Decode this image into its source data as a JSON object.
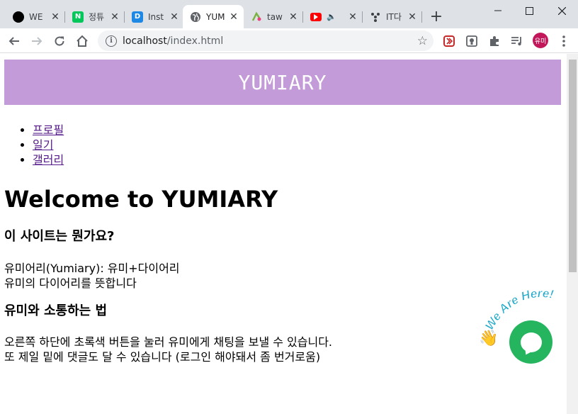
{
  "browser": {
    "tabs": [
      {
        "title": "WE",
        "favicon": "black-circle-icon",
        "color": "#000000",
        "active": false
      },
      {
        "title": "정튜",
        "favicon": "naver-icon",
        "color": "#03c75a",
        "active": false
      },
      {
        "title": "Inst",
        "favicon": "d-letter-icon",
        "color": "#1e88e5",
        "active": false
      },
      {
        "title": "YUM",
        "favicon": "globe-icon",
        "color": "#5f6368",
        "active": true
      },
      {
        "title": "taw",
        "favicon": "tawk-icon",
        "color": "#7cb342",
        "active": false
      },
      {
        "title": "",
        "favicon": "youtube-icon",
        "color": "#ff0000",
        "active": false
      },
      {
        "title": "IT다",
        "favicon": "dots-icon",
        "color": "#3c4043",
        "active": false
      }
    ],
    "address": {
      "host": "localhost",
      "path": "/index.html"
    },
    "profile_label": "유미"
  },
  "page": {
    "banner_title": "YUMIARY",
    "nav": [
      "프로필",
      "일기",
      "갤러리"
    ],
    "heading": "Welcome to YUMIARY",
    "section1": {
      "title": "이 사이트는 뭔가요?",
      "lines": [
        "유미어리(Yumiary): 유미+다이어리",
        "유미의 다이어리를 뜻합니다"
      ]
    },
    "section2": {
      "title": "유미와 소통하는 법",
      "lines": [
        "오른쪽 하단에 초록색 버튼을 눌러 유미에게 채팅을 보낼 수 있습니다.",
        "또 제일 밑에 댓글도 달 수 있습니다 (로그인 해야돼서 좀 번거로움)"
      ]
    },
    "chat_widget": {
      "label": "We Are Here!",
      "button_color": "#24b55e",
      "label_color": "#1fa8c9"
    }
  },
  "colors": {
    "banner": "#c39bd8",
    "link": "#551a8b"
  }
}
